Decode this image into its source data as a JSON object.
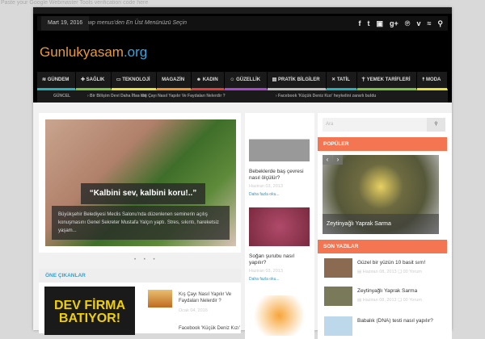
{
  "verification_text": "Paste your Google Webmaster Tools verification code here",
  "topbar": {
    "date": "Mart 19, 2016",
    "menu_hint": "wp menus'den En Üst Menünüzü Seçin",
    "social": [
      "f",
      "t",
      "yt",
      "g+",
      "p",
      "v",
      "rss",
      "search"
    ]
  },
  "logo": {
    "part1": "Gunlukyasam",
    "part2": ".org"
  },
  "nav": [
    {
      "label": "≋ GÜNDEM",
      "color": "#2bb0b8"
    },
    {
      "label": "✚ SAĞLIK",
      "color": "#7cc242"
    },
    {
      "label": "▭ TEKNOLOJİ",
      "color": "#e5e13a"
    },
    {
      "label": "MAGAZİN",
      "color": "#f0932b"
    },
    {
      "label": "☻ KADIN",
      "color": "#e0403a"
    },
    {
      "label": "☺ GÜZELLİK",
      "color": "#a64ac9"
    },
    {
      "label": "▤ PRATİK BİLGİLER",
      "color": "#bbbbbb"
    },
    {
      "label": "✕ TATİL",
      "color": "#2bb0b8"
    },
    {
      "label": "Ⲯ YEMEK TARİFLERİ",
      "color": "#7cc242"
    },
    {
      "label": "☨ MODA",
      "color": "#e5e13a"
    }
  ],
  "ticker": {
    "label": "GÜNCEL",
    "items": [
      "› Bir Bilişim Devi Daha İflas etti",
      "› Kış Çayı Nasıl Yapılır Ve Faydaları Nelerdir ?",
      "› Facebook 'Küçük Deniz Kızı' heykelini zararlı buldu"
    ]
  },
  "slider": {
    "quote": "“Kalbini sev, kalbini koru!..”",
    "excerpt": "Büyükşehir Belediyesi Meclis Salonu'nda düzenlenen seminerin açılış konuşmasını Genel Sekreter Mustafa Yalçın yaptı. Stres, sıkıntı, hareketsiz yaşam...",
    "dots": "• • •"
  },
  "featured": {
    "title": "ÖNE ÇIKANLAR",
    "ad_text": "DEV FİRMA BATIYOR!",
    "items": [
      {
        "title": "Kış Çayı Nasıl Yapılır Ve Faydaları Nelerdir ?",
        "date": "Ocak 04, 2016"
      },
      {
        "title": "Facebook 'Küçük Deniz Kızı'"
      }
    ]
  },
  "middle": [
    {
      "title": "Bebeklerde baş çevresi nasıl ölçülür?",
      "date": "Haziran 03, 2013",
      "more": "Daha fazla oku..."
    },
    {
      "title": "Soğan şurubu nasıl yapılır?",
      "date": "Haziran 03, 2013",
      "more": "Daha fazla oku..."
    }
  ],
  "sidebar": {
    "search_placeholder": "Ara",
    "search_icon": "⚲",
    "popular_title": "POPÜLER",
    "popular_caption": "Zeytinyağlı Yaprak Sarma",
    "recent_title": "SON YAZILAR",
    "recent": [
      {
        "title": "Güzel bir yüzün 10 basit sırrı!",
        "meta": "▤ Haziran 08, 2013   ❏ 00 Yorum"
      },
      {
        "title": "Zeytinyağlı Yaprak Sarma",
        "meta": "▤ Haziran 08, 2013   ❏ 00 Yorum"
      },
      {
        "title": "Babalık (DNA) testi nasıl yapılır?",
        "meta": ""
      }
    ]
  }
}
